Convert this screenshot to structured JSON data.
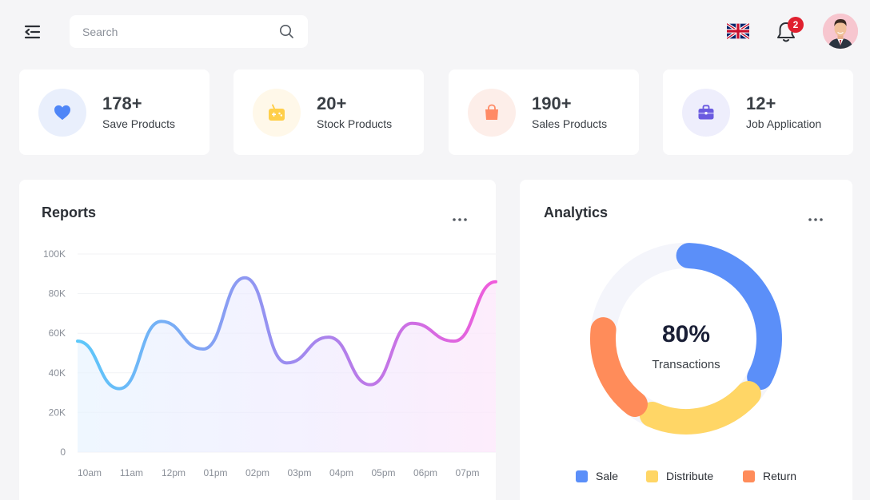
{
  "header": {
    "search_placeholder": "Search",
    "notification_count": "2"
  },
  "stats": [
    {
      "value": "178+",
      "label": "Save Products",
      "icon": "heart-icon",
      "color": "#4f86f7",
      "bg": "#e9effc"
    },
    {
      "value": "20+",
      "label": "Stock Products",
      "icon": "gamepad-icon",
      "color": "#ffcf4a",
      "bg": "#fff8e9"
    },
    {
      "value": "190+",
      "label": "Sales Products",
      "icon": "shopping-bag-icon",
      "color": "#ff8a65",
      "bg": "#fdeee9"
    },
    {
      "value": "12+",
      "label": "Job Application",
      "icon": "briefcase-icon",
      "color": "#6a5ae0",
      "bg": "#eeeefc"
    }
  ],
  "reports": {
    "title": "Reports",
    "chart_data": {
      "type": "line",
      "categories": [
        "10am",
        "11am",
        "12pm",
        "01pm",
        "02pm",
        "03pm",
        "04pm",
        "05pm",
        "06pm",
        "07pm"
      ],
      "values": [
        56,
        32,
        66,
        52,
        88,
        45,
        58,
        34,
        65,
        56,
        86
      ],
      "y_ticks": [
        "100K",
        "80K",
        "60K",
        "40K",
        "20K",
        "0"
      ],
      "ylim": [
        0,
        100
      ]
    }
  },
  "analytics": {
    "title": "Analytics",
    "center_value": "80%",
    "center_label": "Transactions",
    "chart_data": {
      "type": "pie",
      "segments": [
        {
          "name": "Sale",
          "value": 36,
          "color": "#5b8ff9"
        },
        {
          "name": "Distribute",
          "value": 24,
          "color": "#ffd666"
        },
        {
          "name": "Return",
          "value": 20,
          "color": "#ff8c5a"
        }
      ],
      "total": 100
    },
    "legend": [
      {
        "label": "Sale",
        "color": "#5b8ff9"
      },
      {
        "label": "Distribute",
        "color": "#ffd666"
      },
      {
        "label": "Return",
        "color": "#ff8c5a"
      }
    ]
  }
}
